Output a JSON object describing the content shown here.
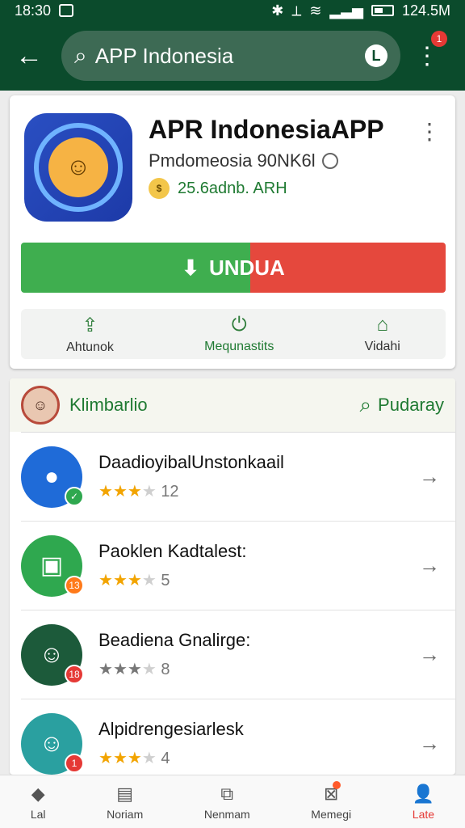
{
  "status_bar": {
    "time": "18:30",
    "right_text": "124.5M"
  },
  "app_bar": {
    "search_query": "APP Indonesia",
    "search_badge": "L",
    "notif_count": "1"
  },
  "app_card": {
    "title": "APR IndonesiaAPP",
    "developer": "Pmdomeosia 90NK6l",
    "meta_text": "25.6adnb. ARH",
    "install_label": "UNDUA",
    "actions": [
      {
        "label": "Ahtunok"
      },
      {
        "label": "Mequnastits"
      },
      {
        "label": "Vidahi"
      }
    ]
  },
  "section": {
    "title": "Klimbarlio",
    "search_label": "Pudaray",
    "items": [
      {
        "name": "DaadioyibalUnstonkaail",
        "stars": 3,
        "count": "12"
      },
      {
        "name": "Paoklen Kadtalest:",
        "stars": 3,
        "count": "5"
      },
      {
        "name": "Beadiena Gnalirge:",
        "stars": 3,
        "count": "8"
      },
      {
        "name": "Alpidrengesiarlesk",
        "stars": 3,
        "count": "4"
      }
    ]
  },
  "bottom_nav": {
    "items": [
      {
        "label": "Lal"
      },
      {
        "label": "Noriam"
      },
      {
        "label": "Nenmam"
      },
      {
        "label": "Memegi"
      },
      {
        "label": "Late"
      }
    ]
  },
  "colors": {
    "primary_dark": "#0b4b2c",
    "green": "#3fae4f",
    "red": "#e5483d"
  }
}
